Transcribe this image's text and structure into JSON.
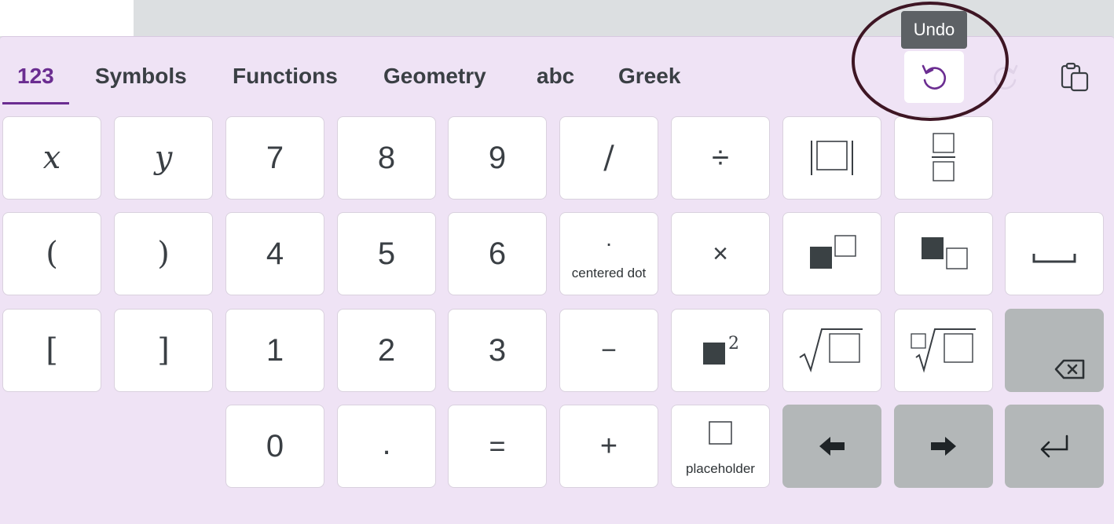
{
  "tabs": [
    {
      "label": "123",
      "active": true
    },
    {
      "label": "Symbols"
    },
    {
      "label": "Functions"
    },
    {
      "label": "Geometry"
    },
    {
      "label": "abc"
    },
    {
      "label": "Greek"
    }
  ],
  "toolbar": {
    "undo_tooltip": "Undo",
    "undo_icon": "undo-icon",
    "redo_icon": "redo-icon",
    "paste_icon": "clipboard-icon"
  },
  "keys": {
    "row1": {
      "x": "x",
      "y": "y",
      "seven": "7",
      "eight": "8",
      "nine": "9",
      "slash": "/",
      "divide": "÷",
      "abs": "abs-value-icon",
      "frac": "fraction-icon"
    },
    "row2": {
      "lparen": "(",
      "rparen": ")",
      "four": "4",
      "five": "5",
      "six": "6",
      "cdot_symbol": "·",
      "cdot_label": "centered dot",
      "times": "×",
      "superscript": "superscript-icon",
      "subscript": "subscript-icon",
      "space": "space-icon"
    },
    "row3": {
      "lbracket": "[",
      "rbracket": "]",
      "one": "1",
      "two": "2",
      "three": "3",
      "minus": "−",
      "squared": "squared-icon",
      "sqrt": "sqrt-icon",
      "nthroot": "nth-root-icon",
      "backspace": "backspace-icon"
    },
    "row4": {
      "zero": "0",
      "dot": ".",
      "equals": "=",
      "plus": "+",
      "placeholder_label": "placeholder",
      "left": "arrow-left-icon",
      "right": "arrow-right-icon",
      "enter": "enter-icon"
    }
  },
  "colors": {
    "accent": "#6b2d91",
    "keyboard_bg": "#efe3f5",
    "key_bg": "#ffffff",
    "dark_key_bg": "#b3b7b8",
    "tooltip_bg": "#5d6165",
    "annotation_circle": "#3e1624"
  }
}
